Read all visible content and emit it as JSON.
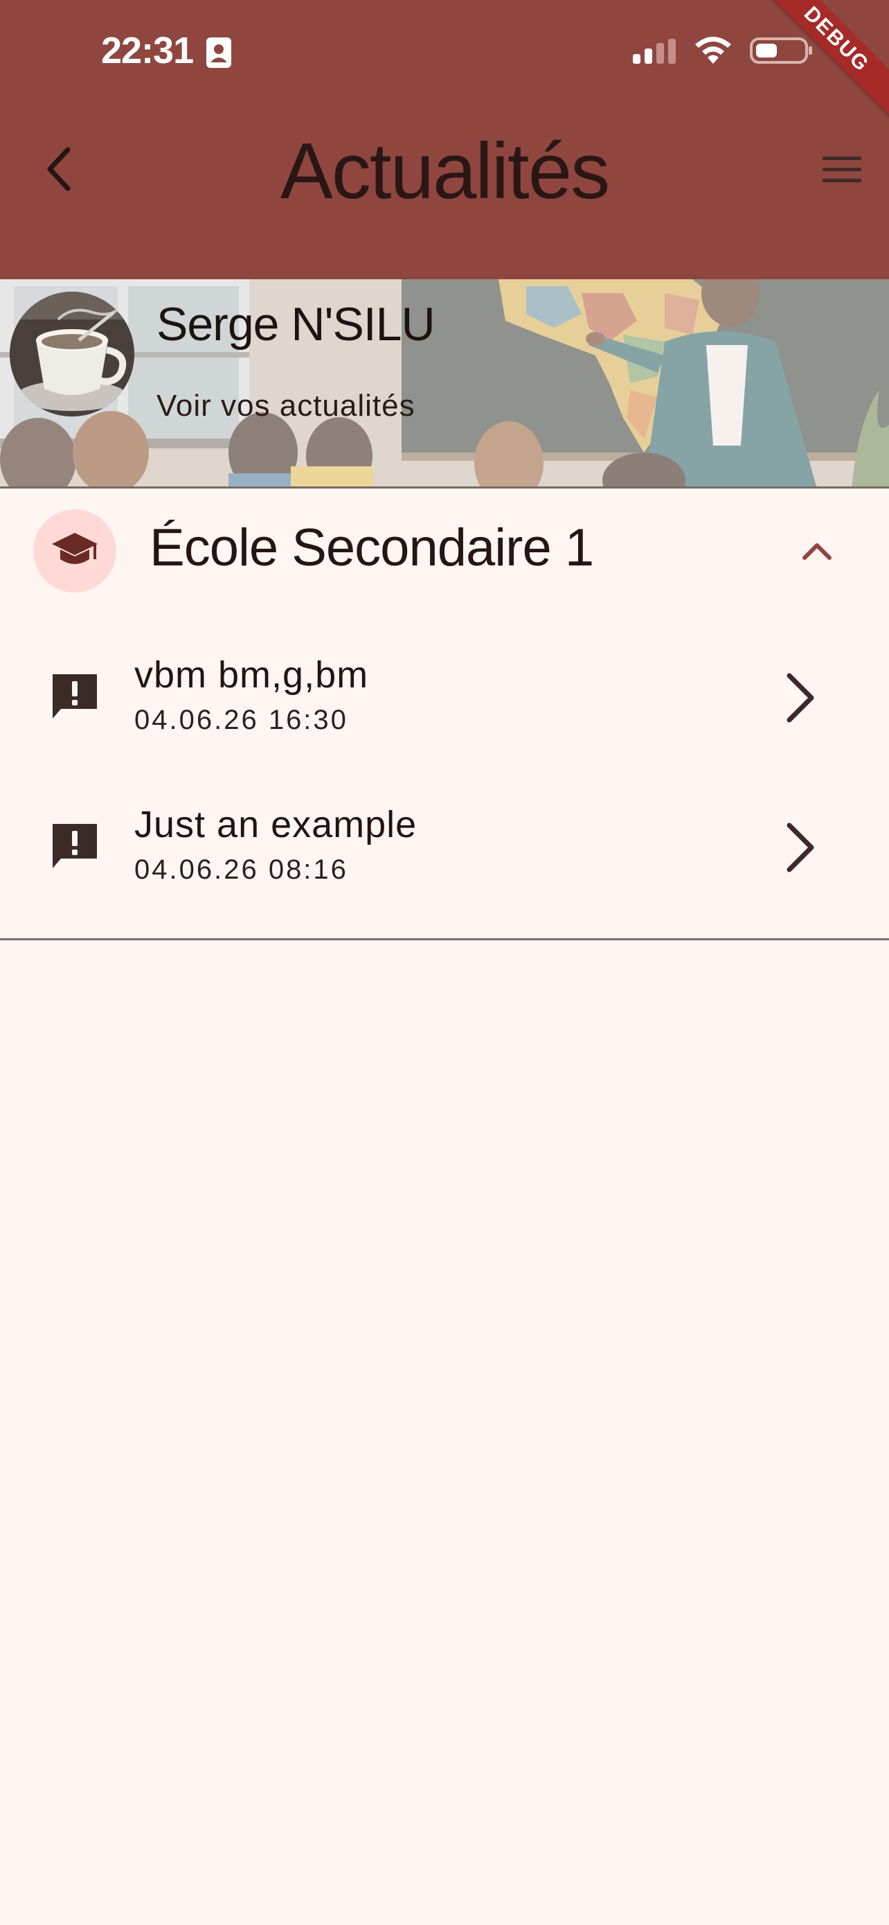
{
  "status_bar": {
    "time": "22:31"
  },
  "debug_ribbon": "DEBUG",
  "app_bar": {
    "title": "Actualités"
  },
  "profile": {
    "name": "Serge N'SILU",
    "subtitle": "Voir vos actualités"
  },
  "school": {
    "title": "École Secondaire 1",
    "expanded": true,
    "news": [
      {
        "title": "vbm bm,g,bm",
        "date": "04.06.26 16:30"
      },
      {
        "title": "Just an example",
        "date": "04.06.26 08:16"
      }
    ]
  },
  "colors": {
    "app_bar": "#8f463f",
    "background": "#fff6f4",
    "icon_circle": "#ffd9d5",
    "accent": "#8f463f"
  },
  "icons": {
    "back": "arrow-back-icon",
    "menu": "hamburger-menu-icon",
    "school": "graduation-cap-icon",
    "collapse": "chevron-up-icon",
    "news": "feedback-alert-icon",
    "open": "chevron-right-icon"
  }
}
